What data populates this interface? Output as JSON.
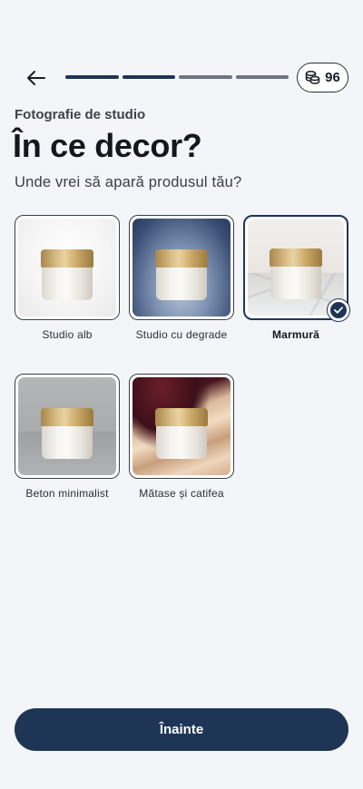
{
  "header": {
    "back_icon": "arrow-left-icon",
    "progress": {
      "total_steps": 4,
      "completed_steps": 2
    },
    "credits": {
      "icon": "coins-stack-icon",
      "value": "96"
    }
  },
  "eyebrow": "Fotografie de studio",
  "title": "În ce decor?",
  "subtitle": "Unde vrei să apară produsul tău?",
  "options": [
    {
      "label": "Studio alb",
      "selected": false
    },
    {
      "label": "Studio cu degrade",
      "selected": false
    },
    {
      "label": "Marmură",
      "selected": true
    },
    {
      "label": "Beton minimalist",
      "selected": false
    },
    {
      "label": "Mătase și catifea",
      "selected": false
    }
  ],
  "cta_label": "Înainte",
  "colors": {
    "accent": "#1e3556",
    "background": "#f3f5f8"
  }
}
